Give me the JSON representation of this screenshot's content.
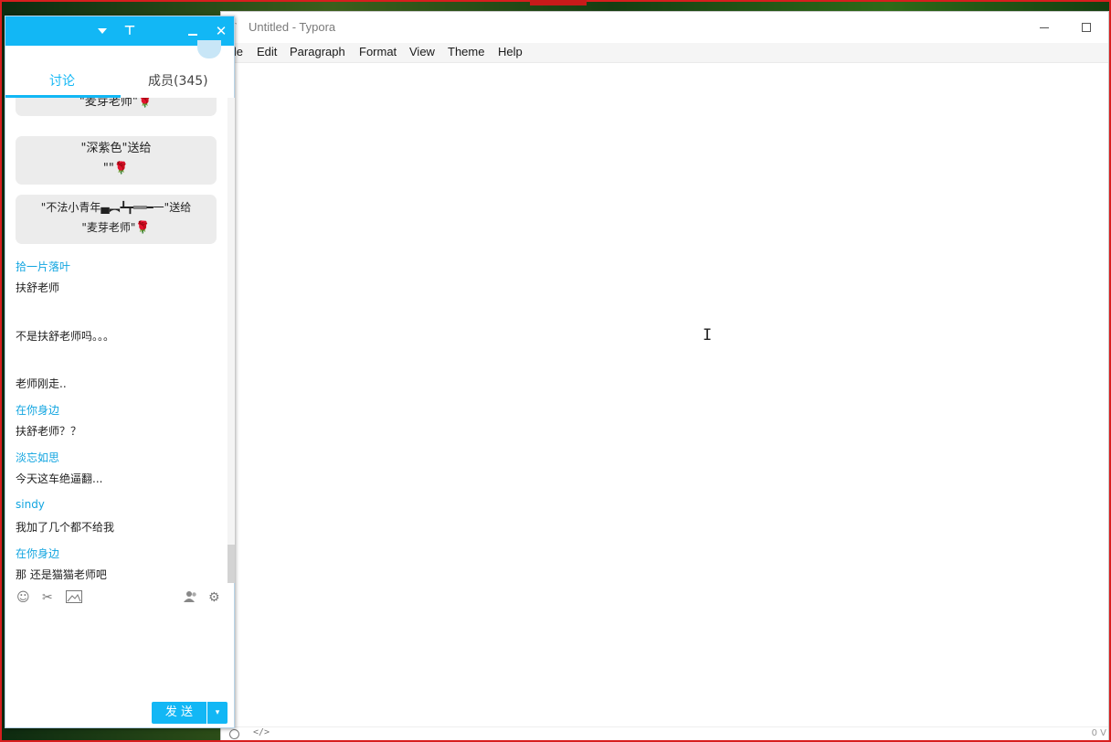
{
  "typora": {
    "app_icon": "T",
    "title": "Untitled - Typora",
    "menu": [
      "ile",
      "Edit",
      "Paragraph",
      "Format",
      "View",
      "Theme",
      "Help"
    ],
    "footer_source": "</>",
    "footer_count": "0 V"
  },
  "qq": {
    "pin_glyph": "⊤",
    "close_glyph": "✕",
    "tabs": {
      "discuss": "讨论",
      "members": "成员(345)"
    },
    "gifts": [
      {
        "line1": "\"麦芽老师\"",
        "line2": ""
      },
      {
        "line1": "\"深紫色\"送给",
        "line2": "\"\""
      },
      {
        "line1": "\"不法小青年▄︻┻┳══━一\"送给",
        "line2": "\"麦芽老师\""
      }
    ],
    "rose": "🌹",
    "messages": [
      {
        "sender": "拾一片落叶",
        "lines": [
          "扶舒老师",
          "不是扶舒老师吗。。。",
          "老师刚走.."
        ]
      },
      {
        "sender": "在你身边",
        "lines": [
          "扶舒老师？？"
        ]
      },
      {
        "sender": "淡忘如思",
        "lines": [
          "今天这车绝逼翻..."
        ]
      },
      {
        "sender": "sindy",
        "lines": [
          "我加了几个都不给我"
        ]
      },
      {
        "sender": "在你身边",
        "lines": [
          "那 还是猫猫老师吧"
        ]
      }
    ],
    "toolbar_icons": [
      "emoji-icon",
      "scissors-icon",
      "image-icon",
      "contacts-icon",
      "gear-icon"
    ],
    "send_label": "发 送",
    "send_dropdown": "▾"
  },
  "colors": {
    "qq_accent": "#12b7f5",
    "recording_frame": "#d81e1e"
  }
}
